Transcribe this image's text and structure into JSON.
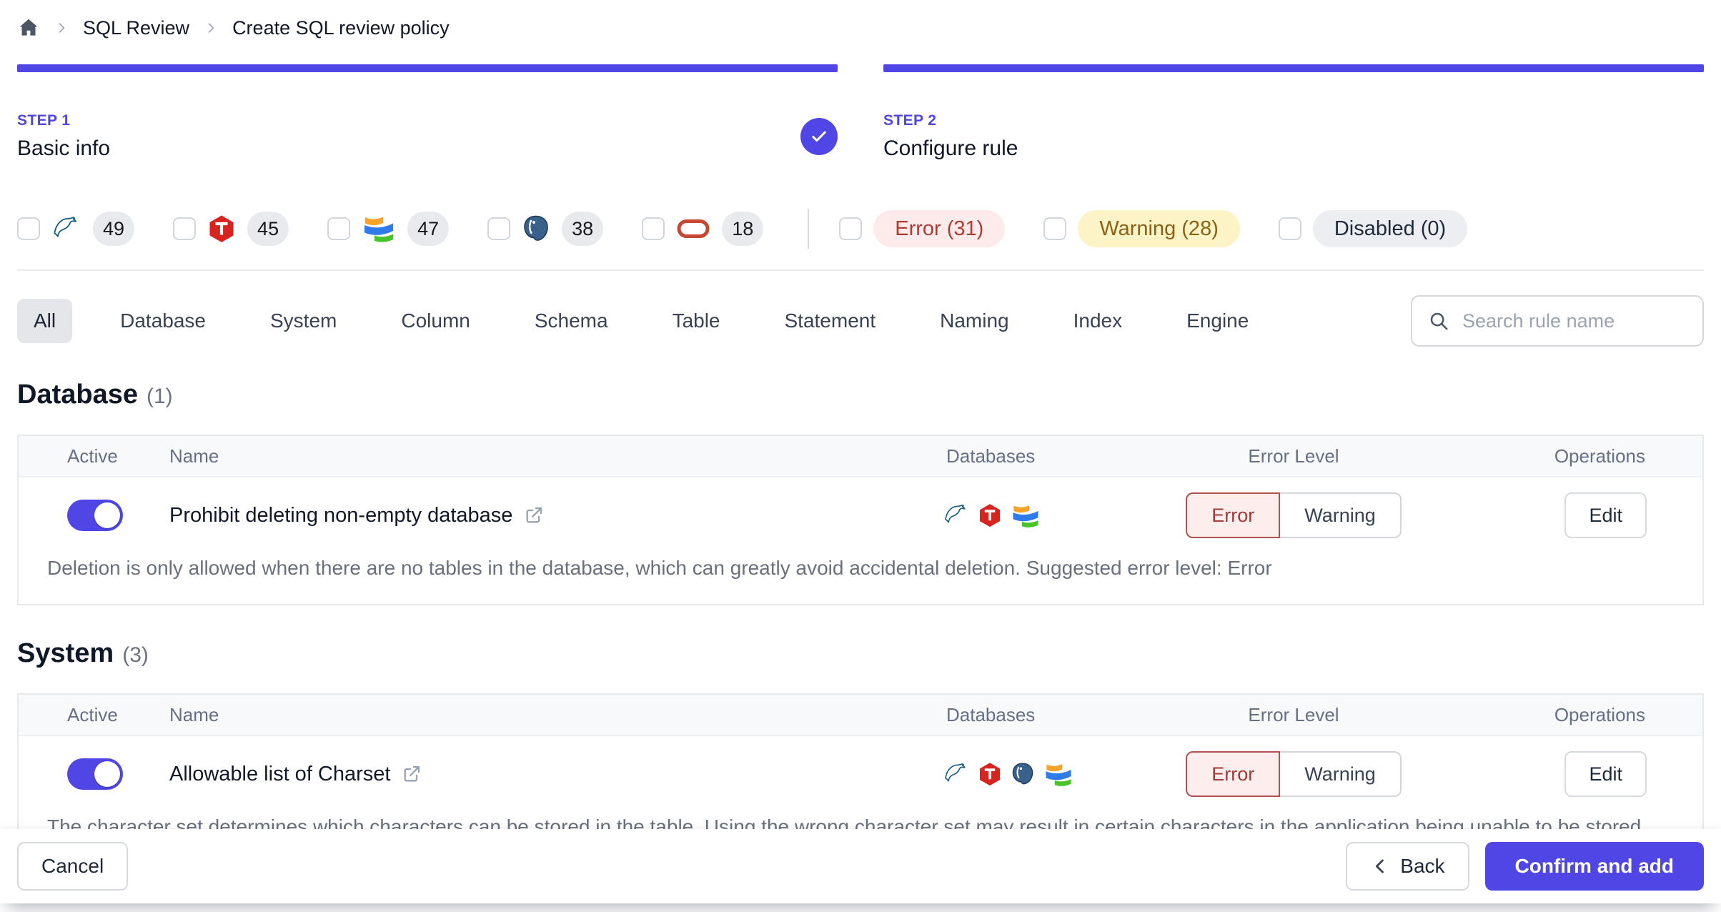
{
  "breadcrumb": {
    "home_label": "Home",
    "items": [
      "SQL Review",
      "Create SQL review policy"
    ]
  },
  "steps": [
    {
      "label": "STEP 1",
      "title": "Basic info",
      "completed": true
    },
    {
      "label": "STEP 2",
      "title": "Configure rule",
      "completed": false
    }
  ],
  "filters": {
    "engines": [
      {
        "name": "MySQL",
        "count": "49"
      },
      {
        "name": "TiDB",
        "count": "45"
      },
      {
        "name": "OceanBase",
        "count": "47"
      },
      {
        "name": "PostgreSQL",
        "count": "38"
      },
      {
        "name": "Oracle",
        "count": "18"
      }
    ],
    "levels": [
      {
        "name": "error",
        "label": "Error (31)"
      },
      {
        "name": "warning",
        "label": "Warning (28)"
      },
      {
        "name": "disabled",
        "label": "Disabled (0)"
      }
    ]
  },
  "tabs": [
    {
      "label": "All",
      "active": true
    },
    {
      "label": "Database"
    },
    {
      "label": "System"
    },
    {
      "label": "Column"
    },
    {
      "label": "Schema"
    },
    {
      "label": "Table"
    },
    {
      "label": "Statement"
    },
    {
      "label": "Naming"
    },
    {
      "label": "Index"
    },
    {
      "label": "Engine"
    }
  ],
  "search": {
    "placeholder": "Search rule name"
  },
  "table": {
    "headers": [
      "Active",
      "Name",
      "Databases",
      "Error Level",
      "Operations"
    ]
  },
  "sections": [
    {
      "title": "Database",
      "count": "(1)",
      "rules": [
        {
          "name": "Prohibit deleting non-empty database",
          "active": true,
          "engines": [
            "MySQL",
            "TiDB",
            "OceanBase"
          ],
          "level": "Error",
          "level_options": [
            "Error",
            "Warning"
          ],
          "description": "Deletion is only allowed when there are no tables in the database, which can greatly avoid accidental deletion. Suggested error level: Error",
          "edit_label": "Edit"
        }
      ]
    },
    {
      "title": "System",
      "count": "(3)",
      "rules": [
        {
          "name": "Allowable list of Charset",
          "active": true,
          "engines": [
            "MySQL",
            "TiDB",
            "PostgreSQL",
            "OceanBase"
          ],
          "level": "Error",
          "level_options": [
            "Error",
            "Warning"
          ],
          "description": "The character set determines which characters can be stored in the table. Using the wrong character set may result in certain characters in the application being unable to be stored and displayed correctly, such as CJK and Emoji. Suggested error level: Error",
          "edit_label": "Edit"
        }
      ]
    }
  ],
  "footer": {
    "cancel_label": "Cancel",
    "back_label": "Back",
    "confirm_label": "Confirm and add"
  },
  "colors": {
    "accent": "#4f46e5",
    "error_text": "#a13b37",
    "error_bg": "#fdeeed",
    "warning_text": "#8a6116",
    "warning_bg": "#fcf3c6",
    "disabled_text": "#1e2a3b",
    "disabled_bg": "#eceef1"
  }
}
